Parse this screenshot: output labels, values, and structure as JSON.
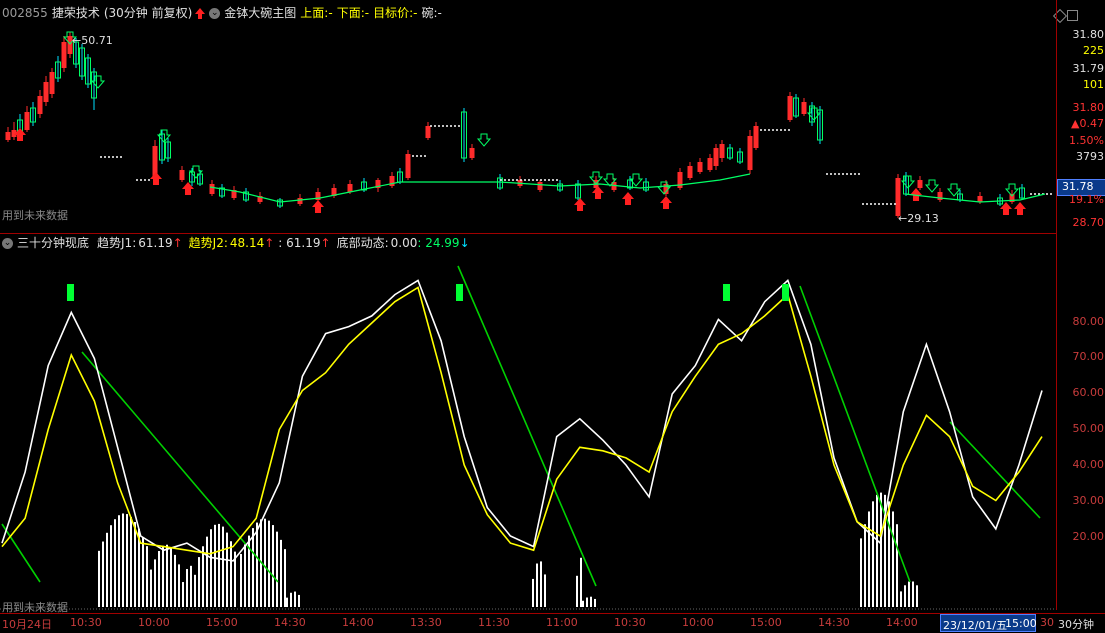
{
  "top_header": {
    "code": "002855",
    "name": "捷荣技术",
    "period": "(30分钟 前复权)",
    "indicator": "金钵大碗主图",
    "up_label": "上面:",
    "up_value": "-",
    "down_label": "下面:",
    "down_value": "-",
    "target_label": "目标价:",
    "target_value": "-",
    "bowl_label": "碗:",
    "bowl_value": "-"
  },
  "price_annotations": {
    "high": "50.71",
    "low": "29.13",
    "future_note_top": "用到未来数据",
    "future_note_bottom": "用到未来数据"
  },
  "top_axis": {
    "labels": [
      "31.80",
      "225",
      "31.79",
      "101",
      "31.80",
      "▲0.47",
      "1.50%",
      "3793"
    ],
    "current_price": "31.78",
    "low_labels": [
      "19.1%",
      "28.70"
    ]
  },
  "sub_header": {
    "indicator": "三十分钟现底",
    "j1_label": "趋势J1:",
    "j1_value": "61.19",
    "j2_label": "趋势J2:",
    "j2_value": "48.14",
    "j3_value": ": 61.19",
    "bottom_label": "底部动态:",
    "bottom_value": "0.00",
    "green_value": ": 24.99"
  },
  "sub_axis": {
    "labels": [
      "80.00",
      "70.00",
      "60.00",
      "50.00",
      "40.00",
      "30.00",
      "20.00"
    ]
  },
  "time_axis": {
    "ticks": [
      "10月24日",
      "10:30",
      "10:00",
      "15:00",
      "14:30",
      "14:00",
      "13:30",
      "11:30",
      "11:00",
      "10:30",
      "10:00",
      "15:00",
      "14:30",
      "14:00",
      "15:00"
    ],
    "cursor_date": "23/12/01/五",
    "cursor_time": "15:00",
    "cursor_extra": "30",
    "period": "30分钟"
  },
  "colors": {
    "rise": "#ff2b2b",
    "fall": "#00e0ff",
    "line_white": "#ffffff",
    "line_yellow": "#ffff00",
    "line_green": "#00d000",
    "axis_red": "#c83c3c",
    "marker_green": "#00ff33"
  },
  "chart_data": {
    "type": "line",
    "series": [
      {
        "name": "趋势J1",
        "values": [
          18,
          38,
          68,
          83,
          70,
          45,
          20,
          16,
          18,
          14,
          13,
          21,
          35,
          65,
          77,
          79,
          82,
          88,
          92,
          75,
          48,
          28,
          20,
          17,
          48,
          53,
          47,
          40,
          31,
          60,
          68,
          81,
          75,
          86,
          92,
          74,
          42,
          24,
          18,
          55,
          74,
          55,
          31,
          22,
          40,
          61
        ]
      },
      {
        "name": "趋势J2",
        "values": [
          17,
          25,
          50,
          71,
          58,
          35,
          18,
          17,
          16,
          15,
          17,
          25,
          50,
          61,
          66,
          74,
          80,
          86,
          90,
          66,
          40,
          26,
          18,
          16,
          36,
          45,
          44,
          42,
          38,
          55,
          65,
          74,
          77,
          82,
          88,
          65,
          40,
          24,
          20,
          40,
          54,
          48,
          34,
          30,
          38,
          48
        ]
      }
    ],
    "ylim": [
      0,
      100
    ],
    "y_ticks": [
      20,
      30,
      40,
      50,
      60,
      70,
      80
    ]
  }
}
